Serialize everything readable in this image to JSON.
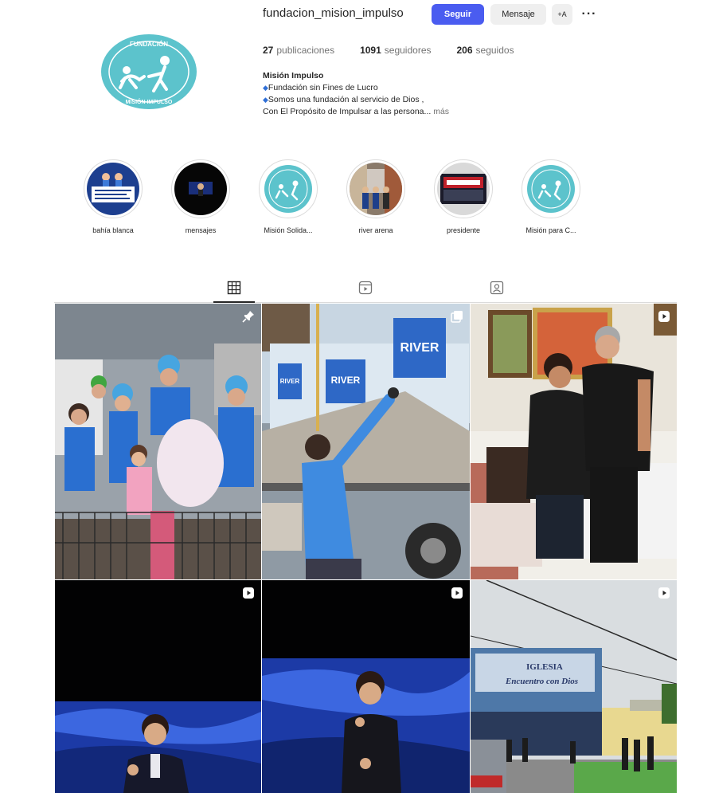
{
  "profile": {
    "username": "fundacion_mision_impulso",
    "follow_label": "Seguir",
    "message_label": "Mensaje",
    "add_label": "+A",
    "more_label": "···",
    "avatar_icon": "foundation-logo",
    "logo_text_top": "FUNDACIÓN",
    "logo_text_bottom": "MISIÓN IMPULSO"
  },
  "stats": {
    "posts_count": "27",
    "posts_label": "publicaciones",
    "followers_count": "1091",
    "followers_label": "seguidores",
    "following_count": "206",
    "following_label": "seguidos"
  },
  "bio": {
    "name": "Misión Impulso",
    "line1": "Fundación sin Fines de Lucro",
    "line2": "Somos una fundación al servicio de Dios ,",
    "line3": "Con El Propósito de Impulsar a las persona...",
    "more": "más"
  },
  "highlights": [
    {
      "label": "bahía blanca"
    },
    {
      "label": "mensajes"
    },
    {
      "label": "Misión Solida..."
    },
    {
      "label": "river arena"
    },
    {
      "label": "presidente"
    },
    {
      "label": "Misión para C..."
    }
  ],
  "tabs": [
    {
      "icon": "grid-icon",
      "active": true
    },
    {
      "icon": "reels-icon",
      "active": false
    },
    {
      "icon": "tagged-icon",
      "active": false
    }
  ],
  "posts": [
    {
      "badge": "pin-icon"
    },
    {
      "badge": "carousel-icon"
    },
    {
      "badge": "reel-icon"
    },
    {
      "badge": "reel-icon"
    },
    {
      "badge": "reel-icon"
    },
    {
      "badge": "reel-icon"
    }
  ],
  "post_texts": {
    "river_sign": "RIVER",
    "church_line1": "IGLESIA",
    "church_line2": "Encuentro con Dios"
  },
  "colors": {
    "accent": "#4a5cf0",
    "logo_teal": "#3fb7c4"
  }
}
